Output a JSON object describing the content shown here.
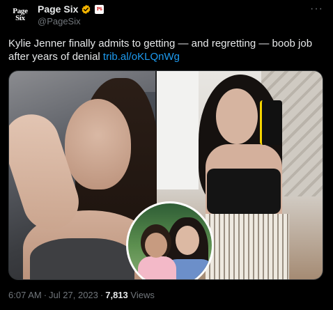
{
  "account": {
    "display_name": "Page Six",
    "handle": "@PageSix",
    "avatar_text_line1": "Page",
    "avatar_text_line2": "Six",
    "affiliate_badge_text": "P6"
  },
  "tweet": {
    "text": "Kylie Jenner finally admits to getting — and regretting — boob job after years of denial ",
    "link": "trib.al/oKLQnWg"
  },
  "footer": {
    "time": "6:07 AM",
    "separator": "·",
    "date": "Jul 27, 2023",
    "views_count": "7,813",
    "views_label": "Views"
  },
  "more_label": "···",
  "colors": {
    "background": "#000000",
    "text": "#e7e9ea",
    "secondary": "#71767b",
    "link": "#1d9bf0",
    "verified": "#f4b400"
  }
}
